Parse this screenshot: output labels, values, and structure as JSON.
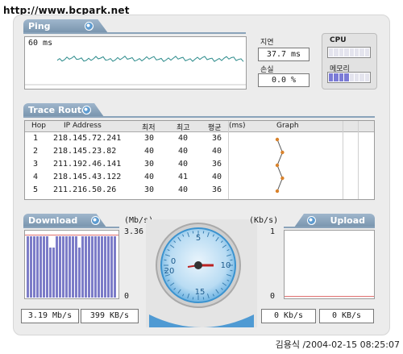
{
  "watermark": "http://www.bcpark.net",
  "credit": "김용식 /2004-02-15 08:25:07",
  "ping": {
    "title": "Ping",
    "current": "60 ms",
    "delay_label": "지연",
    "delay_value": "37.7 ms",
    "loss_label": "손실",
    "loss_value": "0.0 %",
    "cpu_label": "CPU",
    "memory_label": "메모리",
    "memory_usage_fraction": 0.45
  },
  "trace": {
    "title": "Trace Route",
    "columns": {
      "hop": "Hop",
      "ip": "IP Address",
      "min": "최저",
      "max": "최고",
      "avg": "평균",
      "unit": "(ms)",
      "graph": "Graph"
    },
    "rows": [
      {
        "hop": "1",
        "ip": "218.145.72.241",
        "min": "30",
        "max": "40",
        "avg": "36"
      },
      {
        "hop": "2",
        "ip": "218.145.23.82",
        "min": "40",
        "max": "40",
        "avg": "40"
      },
      {
        "hop": "3",
        "ip": "211.192.46.141",
        "min": "30",
        "max": "40",
        "avg": "36"
      },
      {
        "hop": "4",
        "ip": "218.145.43.122",
        "min": "40",
        "max": "41",
        "avg": "40"
      },
      {
        "hop": "5",
        "ip": "211.216.50.26",
        "min": "30",
        "max": "40",
        "avg": "36"
      }
    ]
  },
  "download": {
    "title": "Download",
    "unit": "(Mb/s)",
    "max": "3.36",
    "min": "0",
    "rate_mbps": "3.19 Mb/s",
    "rate_kbs": "399 KB/s"
  },
  "upload": {
    "title": "Upload",
    "unit": "(Kb/s)",
    "max": "1",
    "min": "0",
    "rate_kbps": "0 Kb/s",
    "rate_kbs": "0 KB/s"
  },
  "gauge": {
    "labels": [
      "0",
      "5",
      "10",
      "15",
      "20"
    ]
  },
  "colors": {
    "accent": "#7894ad",
    "bar": "#7c7cc8",
    "graph_line": "#2a8a8a",
    "gauge": "#3b93cf"
  }
}
